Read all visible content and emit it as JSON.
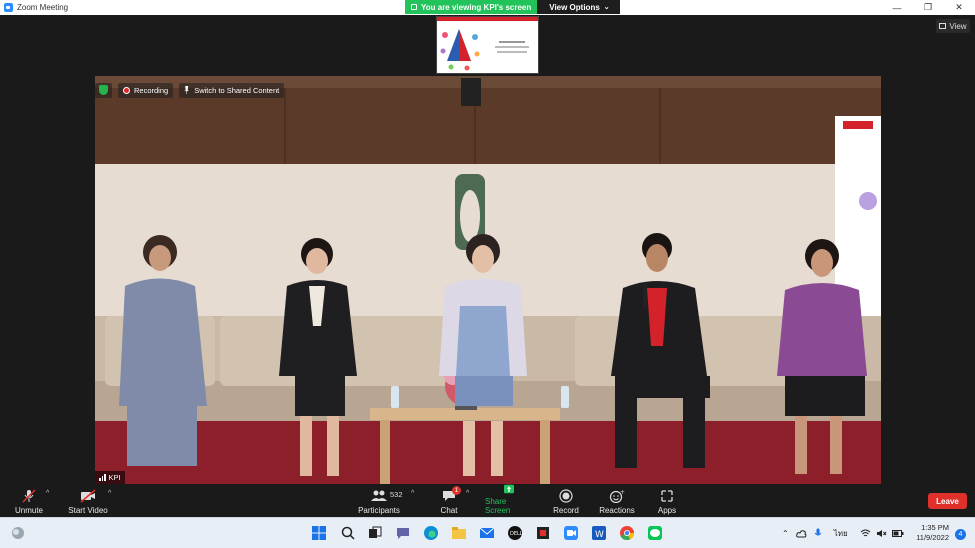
{
  "window": {
    "title": "Zoom Meeting",
    "minimize": "—",
    "maximize": "❐",
    "close": "✕"
  },
  "share_banner": {
    "status": "You are viewing KPI's screen",
    "view_options": "View Options"
  },
  "view_button": {
    "label": "View"
  },
  "video_overlay": {
    "recording": "Recording",
    "switch": "Switch to Shared Content"
  },
  "name_tag": {
    "name": "KPI"
  },
  "toolbar": {
    "unmute": "Unmute",
    "start_video": "Start Video",
    "participants": "Participants",
    "participants_count": "532",
    "chat": "Chat",
    "chat_badge": "1",
    "share_screen": "Share Screen",
    "record": "Record",
    "reactions": "Reactions",
    "apps": "Apps",
    "leave": "Leave"
  },
  "taskbar": {
    "time": "1:35 PM",
    "date": "11/9/2022",
    "language": "ไทย",
    "notifications": "4"
  },
  "colors": {
    "zoom_blue": "#2d8cff",
    "share_green": "#21c35a",
    "leave_red": "#e0302b",
    "recording_red": "#e02828"
  }
}
